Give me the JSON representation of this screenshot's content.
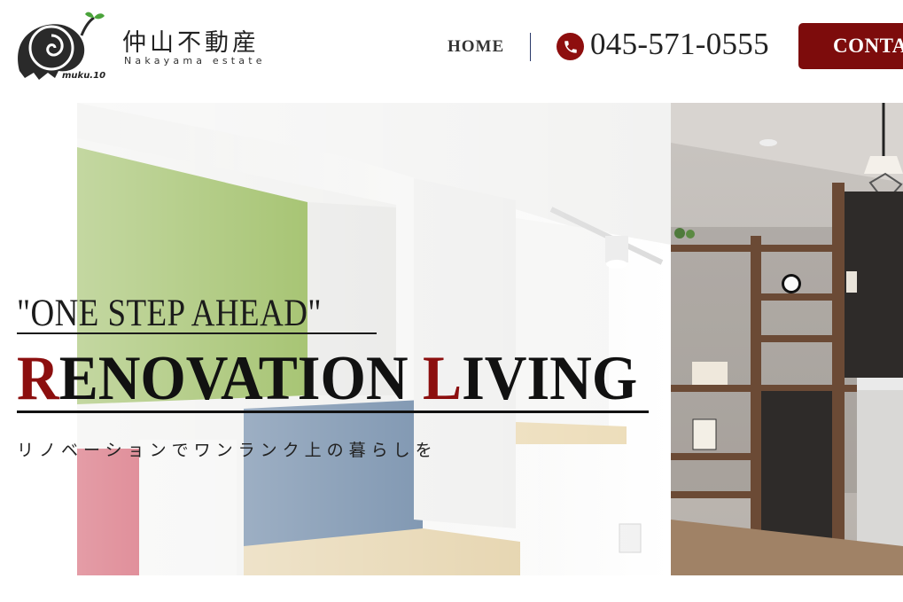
{
  "brand": {
    "logo_caption": "muku.10",
    "name_jp": "仲山不動産",
    "name_en": "Nakayama estate"
  },
  "nav": {
    "home_label": "HOME",
    "phone_number": "045-571-0555",
    "contact_label": "CONTACT"
  },
  "hero": {
    "tagline": "\"ONE STEP AHEAD\"",
    "title_first_initial": "R",
    "title_first_rest": "ENOVATION ",
    "title_second_initial": "L",
    "title_second_rest": "IVING",
    "subtitle": "リノベーションでワンランク上の暮らしを"
  },
  "colors": {
    "accent": "#8c0f0f",
    "text": "#1b1b1b",
    "divider": "#2a3a6a"
  },
  "icons": [
    "logo-snail-icon",
    "phone-icon",
    "mail-icon"
  ]
}
